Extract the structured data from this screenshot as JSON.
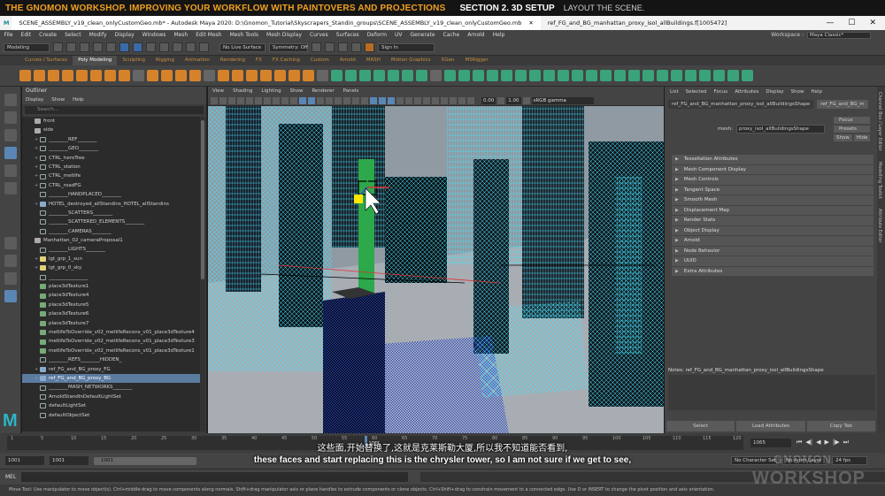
{
  "banner": {
    "title": "THE GNOMON WORKSHOP. IMPROVING YOUR WORKFLOW WITH PAINTOVERS AND PROJECTIONS",
    "section": "SECTION 2. 3D SETUP",
    "subsection": "LAYOUT THE SCENE."
  },
  "titlebar": {
    "tab1": "SCENE_ASSEMBLY_v19_clean_onlyCustomGeo.mb* - Autodesk Maya 2020: D:\\Gnomon_Tutorial\\Skyscrapers_Standin_groups\\SCENE_ASSEMBLY_v19_clean_onlyCustomGeo.mb",
    "tab2": "ref_FG_and_BG_manhattan_proxy_isol_allBuildings.f[1005472]",
    "minimize": "—",
    "maximize": "☐",
    "close": "✕"
  },
  "menubar": {
    "items": [
      "File",
      "Edit",
      "Create",
      "Select",
      "Modify",
      "Display",
      "Windows",
      "Mesh",
      "Edit Mesh",
      "Mesh Tools",
      "Mesh Display",
      "Curves",
      "Surfaces",
      "Deform",
      "UV",
      "Generate",
      "Cache",
      "Arnold",
      "Help"
    ],
    "workspace_label": "Workspace :",
    "workspace_value": "Maya Classic*"
  },
  "statusline": {
    "mode": "Modeling",
    "live_surface": "No Live Surface",
    "symmetry": "Symmetry: Off",
    "sign_in": "Sign In"
  },
  "shelf_tabs": [
    "Curves / Surfaces",
    "Poly Modeling",
    "Sculpting",
    "Rigging",
    "Animation",
    "Rendering",
    "FX",
    "FX Caching",
    "Custom",
    "Arnold",
    "MASH",
    "Motion Graphics",
    "XGen",
    "MSRigger"
  ],
  "shelf_active": "Poly Modeling",
  "outliner": {
    "title": "Outliner",
    "menu": [
      "Display",
      "Show",
      "Help"
    ],
    "search_placeholder": "Search...",
    "rows": [
      {
        "label": "front",
        "icon": "cam",
        "exp": ""
      },
      {
        "label": "side",
        "icon": "cam",
        "exp": ""
      },
      {
        "label": "________REF________",
        "icon": "grp",
        "exp": "+"
      },
      {
        "label": "________GEO________",
        "icon": "grp",
        "exp": "+"
      },
      {
        "label": "CTRL_heroTree",
        "icon": "grp",
        "exp": "+"
      },
      {
        "label": "CTRL_station",
        "icon": "grp",
        "exp": "+"
      },
      {
        "label": "CTRL_metlife",
        "icon": "grp",
        "exp": "+"
      },
      {
        "label": "CTRL_roadFG",
        "icon": "grp",
        "exp": "+"
      },
      {
        "label": "________HANDPLACED________",
        "icon": "grp",
        "exp": ""
      },
      {
        "label": "HOTEL_destroyed_allStandins_HOTEL_allStandins",
        "icon": "mesh",
        "exp": "+"
      },
      {
        "label": "________SCATTERS________",
        "icon": "grp",
        "exp": ""
      },
      {
        "label": "________SCATTERED_ELEMENTS________",
        "icon": "grp",
        "exp": ""
      },
      {
        "label": "________CAMERAS________",
        "icon": "grp",
        "exp": ""
      },
      {
        "label": "Manhattan_02_cameraProposal1",
        "icon": "cam",
        "exp": ""
      },
      {
        "label": "________LIGHTS________",
        "icon": "grp",
        "exp": ""
      },
      {
        "label": "lgt_grp_1_sun",
        "icon": "lit",
        "exp": "+"
      },
      {
        "label": "lgt_grp_0_sky",
        "icon": "lit",
        "exp": "+"
      },
      {
        "label": "________________",
        "icon": "grp",
        "exp": ""
      },
      {
        "label": "place3dTexture1",
        "icon": "tex",
        "exp": ""
      },
      {
        "label": "place3dTexture4",
        "icon": "tex",
        "exp": ""
      },
      {
        "label": "place3dTexture5",
        "icon": "tex",
        "exp": ""
      },
      {
        "label": "place3dTexture6",
        "icon": "tex",
        "exp": ""
      },
      {
        "label": "place3dTexture7",
        "icon": "tex",
        "exp": ""
      },
      {
        "label": "metlifeToOverride_v02_metlifeRecons_v01_place3dTexture4",
        "icon": "tex",
        "exp": ""
      },
      {
        "label": "metlifeToOverride_v02_metlifeRecons_v01_place3dTexture3",
        "icon": "tex",
        "exp": ""
      },
      {
        "label": "metlifeToOverride_v02_metlifeRecons_v01_place3dTexture1",
        "icon": "tex",
        "exp": ""
      },
      {
        "label": "________REFS________HIDDEN_",
        "icon": "grp",
        "exp": ""
      },
      {
        "label": "ref_FG_and_BG_proxy_FG",
        "icon": "mesh",
        "exp": "+"
      },
      {
        "label": "ref_FG_and_BG_proxy_BG",
        "icon": "mesh",
        "exp": "+",
        "sel": true
      },
      {
        "label": "________MASH_NETWORKS________",
        "icon": "grp",
        "exp": ""
      },
      {
        "label": "ArnoldStandInDefaultLightSet",
        "icon": "grp",
        "exp": ""
      },
      {
        "label": "defaultLightSet",
        "icon": "grp",
        "exp": ""
      },
      {
        "label": "defaultObjectSet",
        "icon": "grp",
        "exp": ""
      }
    ]
  },
  "viewport": {
    "menu": [
      "View",
      "Shading",
      "Lighting",
      "Show",
      "Renderer",
      "Panels"
    ],
    "exposure": "0.00",
    "gamma": "1.00",
    "colorspace": "sRGB gamma"
  },
  "attribute_editor": {
    "menu": [
      "List",
      "Selected",
      "Focus",
      "Attributes",
      "Display",
      "Show",
      "Help"
    ],
    "node_tab": "ref_FG_and_BG_manhattan_proxy_isol_allBuildingsShape",
    "node_tab2": "ref_FG_and_BG_m",
    "mesh_label": "mesh:",
    "mesh_value": "proxy_isol_allBuildingsShape",
    "focus_button": "Focus",
    "presets_button": "Presets",
    "show_button": "Show",
    "hide_button": "Hide",
    "sections": [
      "Tessellation Attributes",
      "Mesh Component Display",
      "Mesh Controls",
      "Tangent Space",
      "Smooth Mesh",
      "Displacement Map",
      "Render Stats",
      "Object Display",
      "Arnold",
      "Node Behavior",
      "UUID",
      "Extra Attributes"
    ],
    "notes_label": "Notes: ref_FG_and_BG_manhattan_proxy_isol_allBuildingsShape",
    "buttons": [
      "Select",
      "Load Attributes",
      "Copy Tab"
    ]
  },
  "side_tabs": [
    "Channel Box / Layer Editor",
    "Modelling Toolkit",
    "Attribute Editor"
  ],
  "timeslider": {
    "ticks": [
      "1",
      "5",
      "10",
      "15",
      "20",
      "25",
      "30",
      "35",
      "40",
      "45",
      "50",
      "55",
      "60",
      "65",
      "70",
      "75",
      "80",
      "85",
      "90",
      "95",
      "100",
      "105",
      "110",
      "115",
      "120"
    ],
    "playhead_label": "1065",
    "playhead_fraction": 0.485,
    "current_frame": "1065"
  },
  "rangeslider": {
    "start": "1001",
    "anim_start": "1001",
    "range_label": "1001",
    "character_set": "No Character Set",
    "anim_layer": "No Anim Layer",
    "fps": "24 fps"
  },
  "cmdline": {
    "label": "MEL"
  },
  "helpline": "Move Tool: Use manipulator to move object(s). Ctrl+middle-drag to move components along normals. Shift+drag manipulator axis or plane handles to extrude components or clone objects. Ctrl+Shift+drag to constrain movement to a connected edge. Use D or INSERT to change the pivot position and axis orientation.",
  "subtitles": {
    "zh": "这些面,开始替换了,这就是克莱斯勒大厦,所以我不知道能否看到,",
    "en": "these faces and start replacing this is the chrysler tower, so I am not sure if we get to see,"
  },
  "watermark": {
    "line1": "GNOMON",
    "line2": "WORKSHOP"
  },
  "colors": {
    "accent": "#5b7ba0",
    "wire": "#3fe6ff",
    "brand": "#f0a020"
  }
}
